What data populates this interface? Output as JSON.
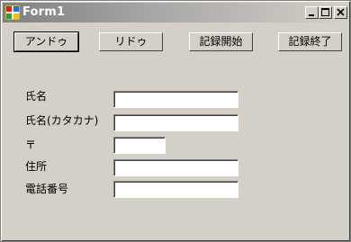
{
  "window": {
    "title": "Form1"
  },
  "toolbar": {
    "undo_label": "アンドゥ",
    "redo_label": "リドゥ",
    "record_start_label": "記録開始",
    "record_end_label": "記録終了"
  },
  "form": {
    "name_label": "氏名",
    "name_value": "",
    "name_kana_label": "氏名(カタカナ)",
    "name_kana_value": "",
    "postal_label": "〒",
    "postal_value": "",
    "address_label": "住所",
    "address_value": "",
    "phone_label": "電話番号",
    "phone_value": ""
  },
  "icons": {
    "app": "form-icon",
    "minimize": "minimize-icon",
    "maximize": "maximize-icon",
    "close": "close-icon"
  }
}
